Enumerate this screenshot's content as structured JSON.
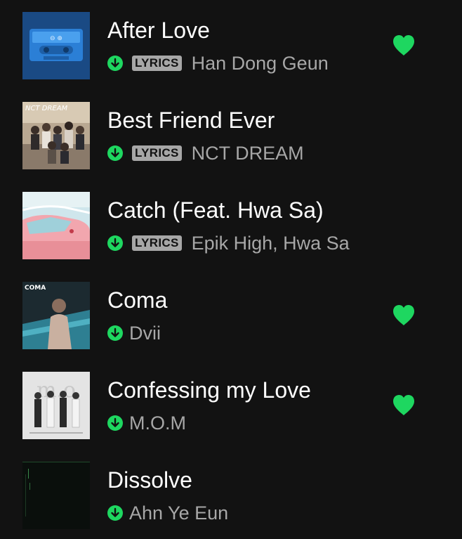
{
  "colors": {
    "background": "#121212",
    "accent": "#1ed760",
    "text_primary": "#ffffff",
    "text_secondary": "#a7a7a7"
  },
  "tracks": [
    {
      "title": "After Love",
      "artist": "Han Dong Geun",
      "lyrics_badge": "LYRICS",
      "downloaded": true,
      "liked": true,
      "art": "cassette-tape-art"
    },
    {
      "title": "Best Friend Ever",
      "artist": "NCT DREAM",
      "lyrics_badge": "LYRICS",
      "downloaded": true,
      "liked": false,
      "art": "group-photo-art",
      "art_text": "NCT DREAM"
    },
    {
      "title": "Catch (Feat. Hwa Sa)",
      "artist": "Epik High, Hwa Sa",
      "lyrics_badge": "LYRICS",
      "downloaded": true,
      "liked": false,
      "art": "pink-car-art"
    },
    {
      "title": "Coma",
      "artist": "Dvii",
      "lyrics_badge": "",
      "downloaded": true,
      "liked": true,
      "art": "portrait-art",
      "art_text": "COMA"
    },
    {
      "title": "Confessing my Love",
      "artist": "M.O.M",
      "lyrics_badge": "",
      "downloaded": true,
      "liked": true,
      "art": "group-bw-art"
    },
    {
      "title": "Dissolve",
      "artist": "Ahn Ye Eun",
      "lyrics_badge": "",
      "downloaded": true,
      "liked": false,
      "art": "dark-art"
    }
  ]
}
